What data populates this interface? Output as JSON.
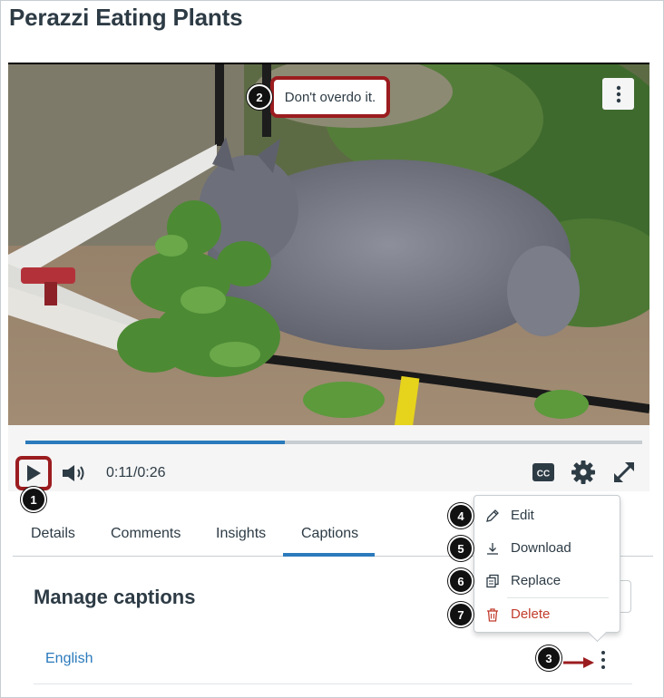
{
  "page": {
    "title": "Perazzi Eating Plants"
  },
  "video": {
    "caption_text": "Don't overdo it.",
    "progress": 0.42,
    "time": "0:11/0:26"
  },
  "tabs": [
    {
      "label": "Details"
    },
    {
      "label": "Comments"
    },
    {
      "label": "Insights"
    },
    {
      "label": "Captions",
      "active": true
    }
  ],
  "captions": {
    "section_title": "Manage captions",
    "language": "English"
  },
  "menu": {
    "items": [
      {
        "label": "Edit",
        "icon": "pencil-icon"
      },
      {
        "label": "Download",
        "icon": "download-icon"
      },
      {
        "label": "Replace",
        "icon": "replace-icon"
      },
      {
        "label": "Delete",
        "icon": "trash-icon"
      }
    ]
  },
  "callouts": [
    "1",
    "2",
    "3",
    "4",
    "5",
    "6",
    "7"
  ],
  "colors": {
    "accent": "#2b7abc",
    "highlight": "#9b1c1f",
    "delete": "#c23c2d",
    "text": "#2d3b45"
  }
}
